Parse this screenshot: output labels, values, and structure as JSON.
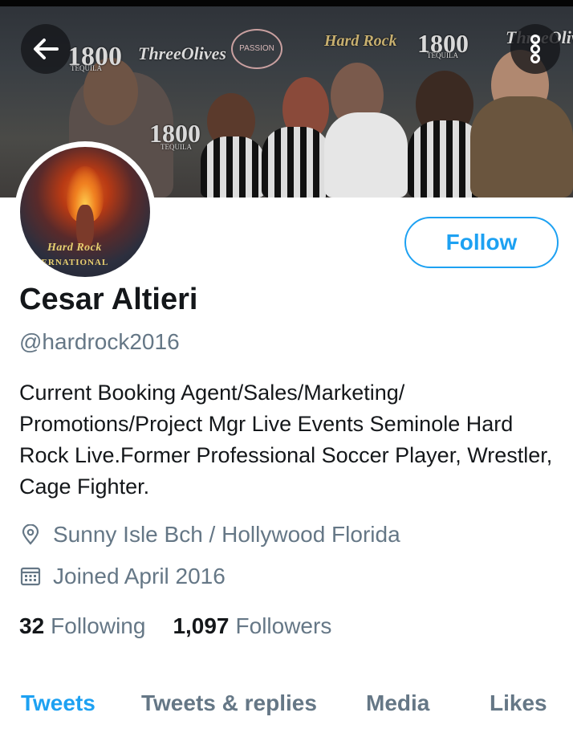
{
  "header": {
    "banner_logos": {
      "logo_1800": "1800",
      "tequila": "TEQUILA",
      "three_olives": "ThreeOlives",
      "hard_rock": "Hard Rock",
      "passion": "PASSION"
    },
    "back_icon": "back-arrow-icon",
    "more_icon": "vertical-dots-icon"
  },
  "profile": {
    "avatar_text": {
      "hard_rock": "Hard Rock",
      "international": "INTERNATIONAL"
    },
    "name": "Cesar Altieri",
    "handle": "@hardrock2016",
    "bio": "Current Booking Agent/Sales/Marketing/ Promotions/Project Mgr Live Events Seminole Hard Rock Live.Former Professional Soccer Player, Wrestler, Cage Fighter.",
    "location": "Sunny Isle Bch / Hollywood Florida",
    "joined": "Joined April 2016",
    "following_count": "32",
    "following_label": "Following",
    "followers_count": "1,097",
    "followers_label": "Followers",
    "follow_label": "Follow"
  },
  "tabs": [
    {
      "label": "Tweets",
      "active": true
    },
    {
      "label": "Tweets & replies",
      "active": false
    },
    {
      "label": "Media",
      "active": false
    },
    {
      "label": "Likes",
      "active": false
    }
  ],
  "colors": {
    "accent": "#1da1f2",
    "text_primary": "#14171a",
    "text_secondary": "#657786"
  }
}
